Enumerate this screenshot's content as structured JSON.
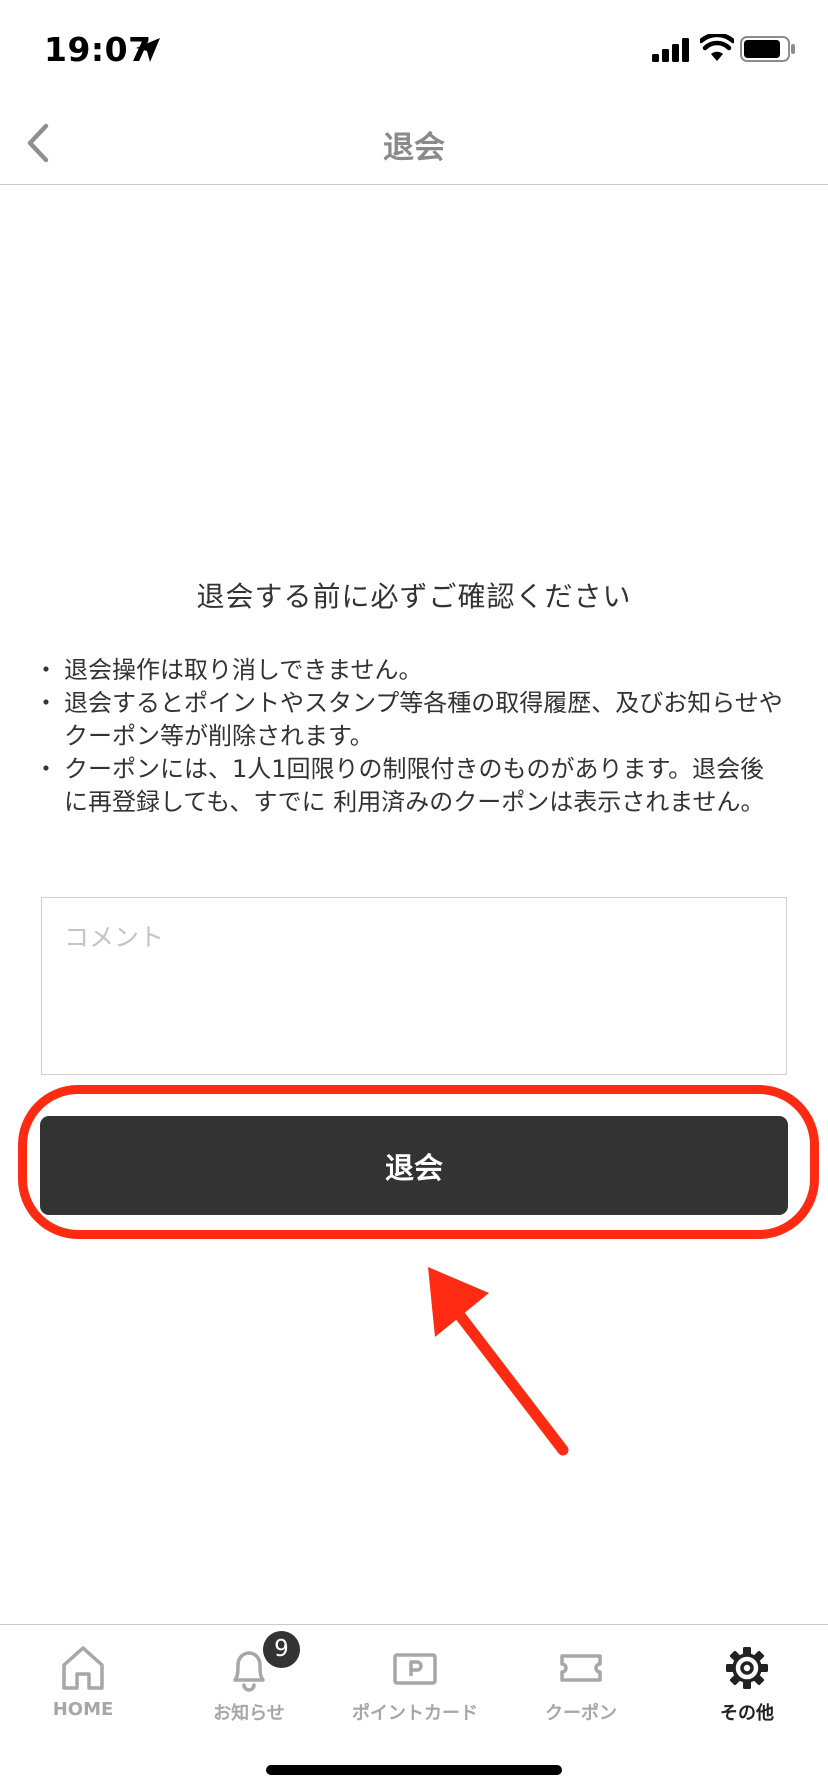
{
  "status_bar": {
    "time": "19:07"
  },
  "nav": {
    "title": "退会"
  },
  "notice": {
    "heading": "退会する前に必ずご確認ください",
    "items": [
      "退会操作は取り消しできません。",
      "退会するとポイントやスタンプ等各種の取得履歴、及びお知らせやクーポン等が削除されます。",
      "クーポンには、1人1回限りの制限付きのものがあります。退会後に再登録しても、すでに 利用済みのクーポンは表示されません。"
    ]
  },
  "comment": {
    "placeholder": "コメント",
    "value": ""
  },
  "withdraw_button": {
    "label": "退会"
  },
  "annotation": {
    "highlight_color": "#ff2a12"
  },
  "tab_bar": {
    "active_index": 4,
    "items": [
      {
        "label": "HOME",
        "icon": "home-icon"
      },
      {
        "label": "お知らせ",
        "icon": "bell-icon",
        "badge": "9"
      },
      {
        "label": "ポイントカード",
        "icon": "point-card-icon"
      },
      {
        "label": "クーポン",
        "icon": "coupon-icon"
      },
      {
        "label": "その他",
        "icon": "gear-icon"
      }
    ]
  },
  "colors": {
    "button_bg": "#333333",
    "inactive_tab": "#a7a7a7",
    "active_tab": "#222222"
  }
}
